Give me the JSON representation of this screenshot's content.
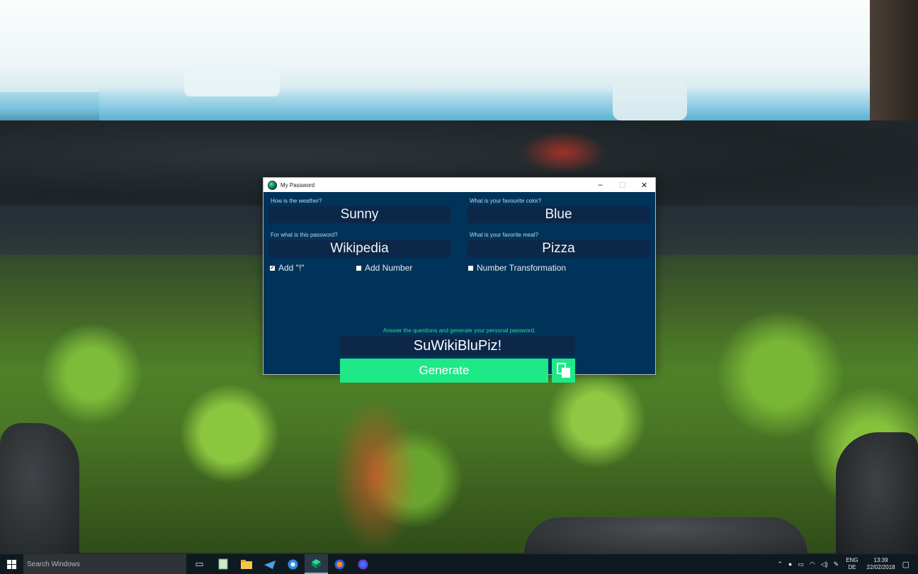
{
  "window": {
    "title": "My Password",
    "minimize": "–",
    "maximize": "☐",
    "close": "✕"
  },
  "form": {
    "q1_label": "How is the weather?",
    "q1_value": "Sunny",
    "q2_label": "What is your favourite color?",
    "q2_value": "Blue",
    "q3_label": "For what is this password?",
    "q3_value": "Wikipedia",
    "q4_label": "What is your favorite meal?",
    "q4_value": "Pizza"
  },
  "options": [
    {
      "label": "Add \"!\"",
      "checked": true
    },
    {
      "label": "Add Number",
      "checked": false
    },
    {
      "label": "Number Transformation",
      "checked": false
    }
  ],
  "hint": "Answer the questions and generate your personal password.",
  "password": "SuWikiBluPiz!",
  "generate_label": "Generate",
  "taskbar": {
    "search_placeholder": "Search Windows",
    "lang_top": "ENG",
    "lang_bottom": "DE",
    "time": "13:39",
    "date": "22/02/2018"
  },
  "colors": {
    "window_bg": "#00335a",
    "field_bg": "#0c2748",
    "accent": "#1fe887",
    "hint": "#37d98c"
  },
  "icons": [
    "windows-logo-icon",
    "task-view-icon",
    "notepad-icon",
    "file-explorer-icon",
    "mail-icon",
    "browser-icon",
    "my-password-app-icon",
    "firefox-icon",
    "firefox-nightly-icon",
    "chevron-up-icon",
    "network-icon",
    "battery-icon",
    "wifi-icon",
    "volume-icon",
    "pen-icon",
    "notification-icon",
    "copy-icon"
  ]
}
